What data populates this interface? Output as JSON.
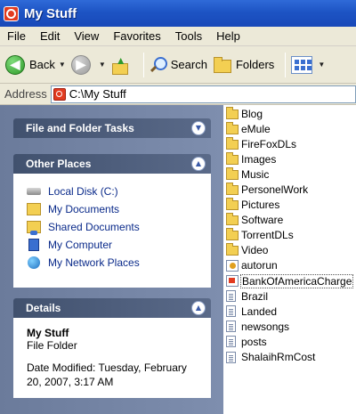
{
  "window": {
    "title": "My Stuff",
    "icon": "window-app-icon"
  },
  "menu": [
    "File",
    "Edit",
    "View",
    "Favorites",
    "Tools",
    "Help"
  ],
  "toolbar": {
    "back_label": "Back",
    "search_label": "Search",
    "folders_label": "Folders"
  },
  "address": {
    "label": "Address",
    "path": "C:\\My Stuff"
  },
  "tasks": {
    "file_folder_tasks": "File and Folder Tasks",
    "other_places": {
      "title": "Other Places",
      "items": [
        "Local Disk (C:)",
        "My Documents",
        "Shared Documents",
        "My Computer",
        "My Network Places"
      ]
    },
    "details": {
      "title": "Details",
      "name": "My Stuff",
      "type": "File Folder",
      "modified": "Date Modified: Tuesday, February 20, 2007, 3:17 AM"
    }
  },
  "files": [
    {
      "name": "Blog",
      "kind": "folder"
    },
    {
      "name": "eMule",
      "kind": "folder"
    },
    {
      "name": "FireFoxDLs",
      "kind": "folder"
    },
    {
      "name": "Images",
      "kind": "folder"
    },
    {
      "name": "Music",
      "kind": "folder"
    },
    {
      "name": "PersonelWork",
      "kind": "folder"
    },
    {
      "name": "Pictures",
      "kind": "folder"
    },
    {
      "name": "Software",
      "kind": "folder"
    },
    {
      "name": "TorrentDLs",
      "kind": "folder"
    },
    {
      "name": "Video",
      "kind": "folder"
    },
    {
      "name": "autorun",
      "kind": "autorun"
    },
    {
      "name": "BankOfAmericaCharge",
      "kind": "file"
    },
    {
      "name": "Brazil",
      "kind": "text"
    },
    {
      "name": "Landed",
      "kind": "text"
    },
    {
      "name": "newsongs",
      "kind": "text"
    },
    {
      "name": "posts",
      "kind": "text"
    },
    {
      "name": "ShalaihRmCost",
      "kind": "text"
    }
  ],
  "colors": {
    "titlebar": "#1f56c6",
    "taskpane": "#7383a3",
    "link": "#0a2a8a"
  }
}
